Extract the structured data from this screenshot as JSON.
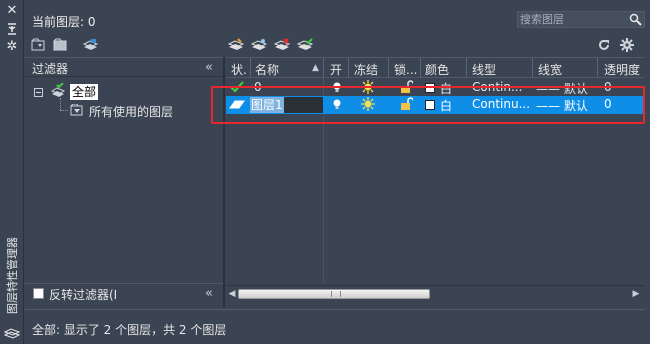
{
  "panel": {
    "title": "图层特性管理器",
    "current_layer_label": "当前图层: 0",
    "search_placeholder": "搜索图层"
  },
  "strip": {
    "icons": [
      "close-icon",
      "pin-icon",
      "settings-icon"
    ]
  },
  "toolbar": {
    "left_icons": [
      "new-property-filter-icon",
      "new-group-filter-icon",
      "layer-states-manager-icon"
    ],
    "right_icons": [
      "new-layer-icon",
      "new-layer-vp-frozen-icon",
      "delete-layer-icon",
      "set-current-icon"
    ],
    "refresh_icon": "refresh-icon",
    "settings_icon": "gear-icon"
  },
  "filters": {
    "title": "过滤器",
    "tree": [
      {
        "label": "全部",
        "selected": true
      },
      {
        "label": "所有使用的图层",
        "selected": false
      }
    ],
    "invert_label": "反转过滤器(I",
    "invert_checked": false
  },
  "table": {
    "columns": [
      "状.",
      "名称",
      "开",
      "冻结",
      "锁...",
      "颜色",
      "线型",
      "线宽",
      "透明度"
    ],
    "rows": [
      {
        "status": "current",
        "name": "0",
        "on": true,
        "freeze": "sun",
        "lock": "unlocked",
        "color_name": "白",
        "color_hex": "#ffffff",
        "linetype": "Contin...",
        "lineweight": "—— 默认",
        "transparency": "0",
        "selected": false
      },
      {
        "status": "layer",
        "name": "图层1",
        "on": true,
        "freeze": "sun",
        "lock": "unlocked",
        "color_name": "白",
        "color_hex": "#ffffff",
        "linetype": "Continu...",
        "lineweight": "—— 默认",
        "transparency": "0",
        "selected": true
      }
    ]
  },
  "status_bar": {
    "text": "全部: 显示了 2 个图层，共 2 个图层"
  },
  "colors": {
    "panel_bg": "#3b4453",
    "selection": "#0f8ee8",
    "highlight_box": "#e8282c"
  }
}
